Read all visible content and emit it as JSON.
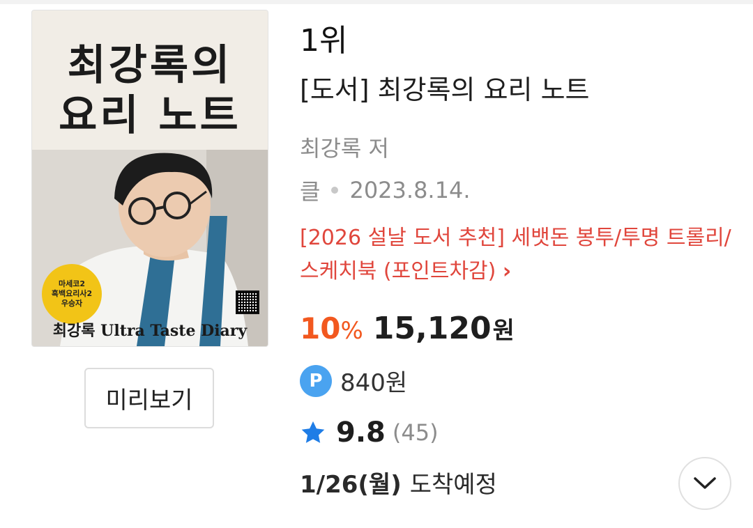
{
  "cover": {
    "title_line1": "최강록의",
    "title_line2": "요리 노트",
    "badge_line1": "마세코2",
    "badge_line2": "흑백요리사2",
    "badge_line3": "우승자",
    "subtitle": "최강록 Ultra Taste Diary"
  },
  "preview_label": "미리보기",
  "book": {
    "rank": "1위",
    "title": "[도서] 최강록의 요리 노트",
    "author": "최강록 저",
    "publisher": "클",
    "pub_date": "2023.8.14.",
    "promo_text": "[2026 설날 도서 추천] 세뱃돈 봉투/투명 트롤리/스케치북 (포인트차감)",
    "promo_arrow": "›",
    "discount": "10",
    "discount_unit": "%",
    "price": "15,120",
    "price_unit": "원",
    "points_icon": "P",
    "points": "840원",
    "rating": "9.8",
    "review_count": "(45)",
    "delivery_date": "1/26(월)",
    "delivery_status": "도착예정"
  },
  "colors": {
    "promo": "#e0463c",
    "discount": "#f2581f",
    "points_icon": "#4aa3f0",
    "star": "#1f7de6"
  },
  "icons": {
    "points": "points-icon",
    "rating": "star-icon",
    "expand": "chevron-down-icon"
  }
}
